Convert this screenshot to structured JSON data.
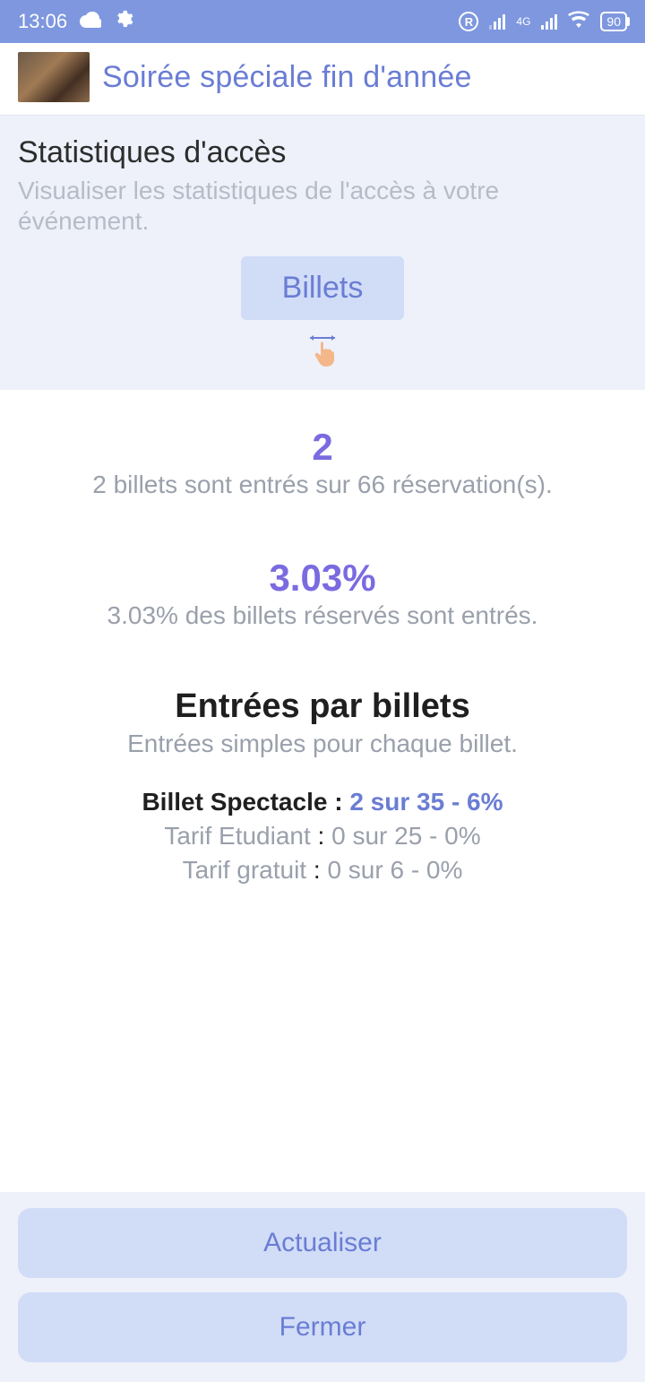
{
  "statusbar": {
    "time": "13:06",
    "network_label": "4G",
    "battery": "90"
  },
  "header": {
    "title": "Soirée spéciale fin d'année"
  },
  "top": {
    "title": "Statistiques d'accès",
    "subtitle": "Visualiser les statistiques de l'accès à votre événement.",
    "chip": "Billets"
  },
  "stats": {
    "count_big": "2",
    "count_sub": "2 billets sont entrés sur 66 réservation(s).",
    "pct_big": "3.03%",
    "pct_sub": "3.03% des billets réservés sont entrés."
  },
  "entries": {
    "title": "Entrées par billets",
    "subtitle": "Entrées simples pour chaque billet.",
    "rows": [
      {
        "label": "Billet Spectacle",
        "value": "2 sur 35 - 6%",
        "active": true
      },
      {
        "label": "Tarif Etudiant",
        "value": "0 sur 25 - 0%",
        "active": false
      },
      {
        "label": "Tarif gratuit",
        "value": "0 sur 6 - 0%",
        "active": false
      }
    ]
  },
  "footer": {
    "refresh": "Actualiser",
    "close": "Fermer"
  }
}
